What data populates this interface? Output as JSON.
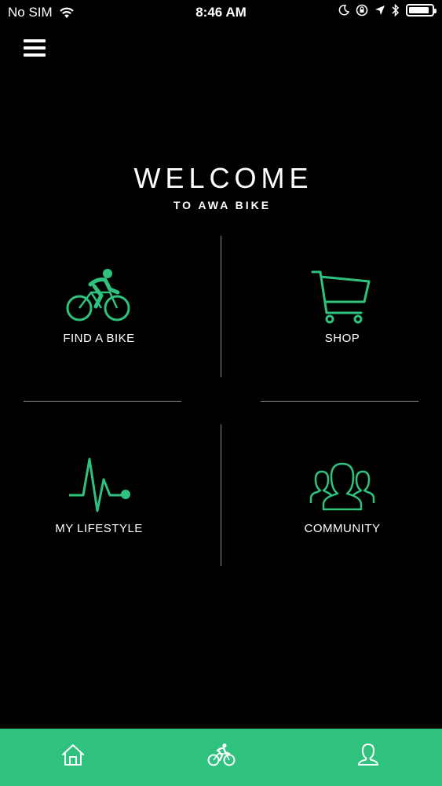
{
  "status_bar": {
    "carrier": "No SIM",
    "time": "8:46 AM",
    "battery_level": 0.9
  },
  "header": {
    "menu_icon": "hamburger-menu-icon"
  },
  "welcome": {
    "title": "WELCOME",
    "subtitle": "TO AWA BIKE"
  },
  "tiles": [
    {
      "label": "FIND A BIKE",
      "icon": "bicycle-rider-icon"
    },
    {
      "label": "SHOP",
      "icon": "shopping-cart-icon"
    },
    {
      "label": "MY LIFESTYLE",
      "icon": "heartbeat-icon"
    },
    {
      "label": "COMMUNITY",
      "icon": "community-people-icon"
    }
  ],
  "tab_bar": {
    "tabs": [
      {
        "icon": "home-icon"
      },
      {
        "icon": "bicycle-rider-icon"
      },
      {
        "icon": "user-profile-icon"
      }
    ]
  },
  "colors": {
    "accent": "#2ec27e",
    "background": "#000000",
    "divider": "#8a8a8a",
    "text": "#ffffff"
  }
}
